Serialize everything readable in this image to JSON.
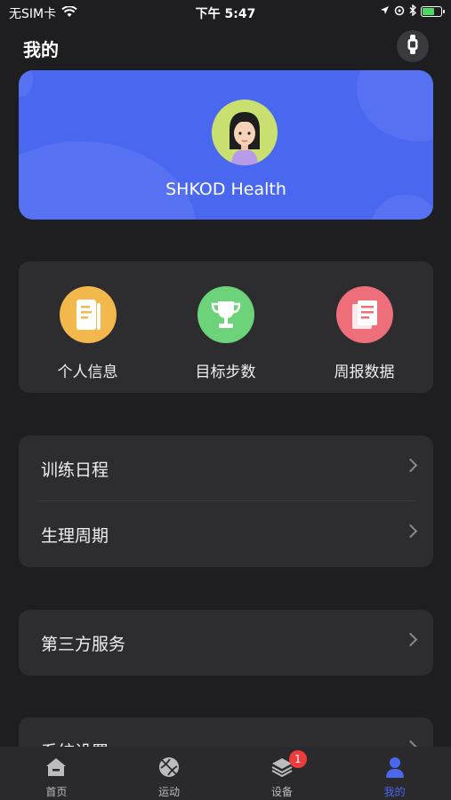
{
  "status_bar": {
    "carrier": "无SIM卡",
    "time": "下午 5:47"
  },
  "header": {
    "title": "我的"
  },
  "profile": {
    "name": "SHKOD Health"
  },
  "quick_actions": [
    {
      "label": "个人信息",
      "icon": "notebook-icon",
      "color": "#f2b84b"
    },
    {
      "label": "目标步数",
      "icon": "trophy-icon",
      "color": "#6dd37a"
    },
    {
      "label": "周报数据",
      "icon": "report-icon",
      "color": "#ee6f7a"
    }
  ],
  "menu": {
    "group1": [
      {
        "label": "训练日程"
      },
      {
        "label": "生理周期"
      }
    ],
    "group2": [
      {
        "label": "第三方服务"
      }
    ],
    "group3": [
      {
        "label": "系统设置"
      }
    ]
  },
  "tab_bar": {
    "tabs": [
      {
        "label": "首页",
        "icon": "home-icon"
      },
      {
        "label": "运动",
        "icon": "ball-icon"
      },
      {
        "label": "设备",
        "icon": "layers-icon",
        "badge": "1"
      },
      {
        "label": "我的",
        "icon": "person-icon",
        "active": true
      }
    ]
  },
  "colors": {
    "accent": "#4a67f0",
    "background": "#1e1e20",
    "card": "#2d2d30",
    "badge": "#ee3b3b"
  }
}
